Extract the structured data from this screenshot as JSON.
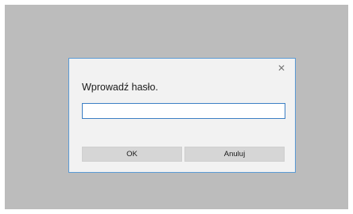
{
  "dialog": {
    "close_icon": "close-icon",
    "close_glyph": "✕",
    "prompt": "Wprowadź hasło.",
    "password_value": "",
    "ok_label": "OK",
    "cancel_label": "Anuluj"
  },
  "colors": {
    "backdrop": "#bcbcbc",
    "dialog_background": "#f2f2f2",
    "dialog_border": "#5b9bd5",
    "input_border": "#3c7fc4",
    "button_background": "#d6d6d6"
  }
}
